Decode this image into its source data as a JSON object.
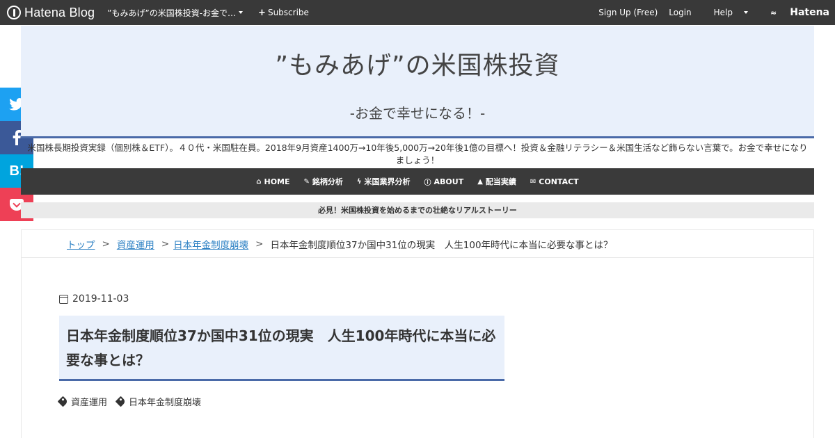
{
  "topbar": {
    "logo_text": "Hatena Blog",
    "blog_name": "”もみあげ”の米国株投資-お金で…",
    "subscribe": "Subscribe",
    "signup": "Sign Up (Free)",
    "login": "Login",
    "help": "Help",
    "hatena": "Hatena"
  },
  "header": {
    "title": "”もみあげ”の米国株投資",
    "subtitle": "-お金で幸せになる！-"
  },
  "description": "米国株長期投資実録（個別株＆ETF）。４０代・米国駐在員。2018年9月資産1400万→10年後5,000万→20年後1億の目標へ！投資＆金融リテラシー＆米国生活など飾らない言葉で。お金で幸せになりましょう！",
  "nav": [
    {
      "icon": "home-icon",
      "glyph": "⌂",
      "label": "HOME"
    },
    {
      "icon": "wrench-icon",
      "glyph": "✎",
      "label": "銘柄分析"
    },
    {
      "icon": "bolt-icon",
      "glyph": "ϟ",
      "label": "米国業界分析"
    },
    {
      "icon": "info-icon",
      "glyph": "ⓘ",
      "label": "ABOUT"
    },
    {
      "icon": "graduation-cap-icon",
      "glyph": "▲",
      "label": "配当実績"
    },
    {
      "icon": "envelope-icon",
      "glyph": "✉",
      "label": "CONTACT"
    }
  ],
  "promo": "必見！米国株投資を始めるまでの壮絶なリアルストーリー",
  "breadcrumb": {
    "top": "トップ",
    "cat1": "資産運用",
    "cat2": "日本年金制度崩壊",
    "current": "日本年金制度順位37か国中31位の現実　人生100年時代に本当に必要な事とは？",
    "sep": ">"
  },
  "post": {
    "date": "2019-11-03",
    "title": "日本年金制度順位37か国中31位の現実　人生100年時代に本当に必要な事とは？",
    "categories": [
      "資産運用",
      "日本年金制度崩壊"
    ]
  },
  "share": {
    "twitter": "twitter-icon",
    "facebook": "facebook-icon",
    "hatebu_label": "B!",
    "pocket": "pocket-icon"
  },
  "colors": {
    "topbar_bg": "#393939",
    "header_bg": "#e9f0fb",
    "accent": "#4a6aa8",
    "nav_bg": "#3a3a3a",
    "twitter": "#1da1f2",
    "facebook": "#3b5998",
    "hatebu": "#00a4de",
    "pocket": "#ee4056",
    "link": "#2a7fc3"
  }
}
